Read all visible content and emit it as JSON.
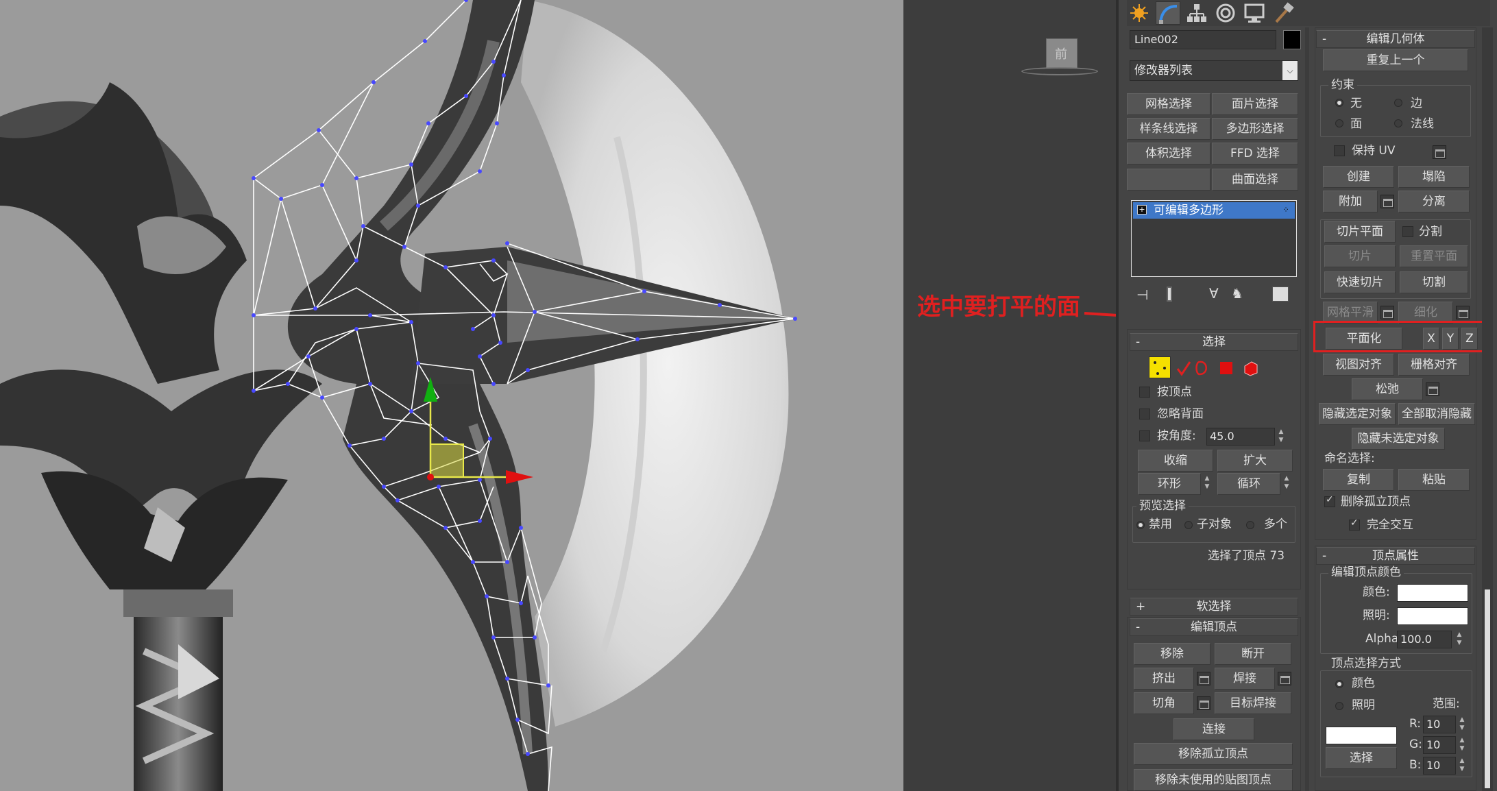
{
  "annotation": {
    "text": "选中要打平的面",
    "color": "#e02020"
  },
  "viewport": {
    "label": "前",
    "background": "#9a9a9a"
  },
  "command_tabs": [
    "create-icon",
    "modify-icon",
    "hierarchy-icon",
    "motion-icon",
    "display-icon",
    "utilities-icon"
  ],
  "object": {
    "name": "Line002",
    "color": "#000000"
  },
  "modifier_list": {
    "label": "修改器列表"
  },
  "modifier_buttons": [
    {
      "label": "网格选择"
    },
    {
      "label": "面片选择"
    },
    {
      "label": "样条线选择"
    },
    {
      "label": "多边形选择"
    },
    {
      "label": "体积选择"
    },
    {
      "label": "FFD 选择"
    },
    {
      "label": ""
    },
    {
      "label": "曲面选择"
    }
  ],
  "stack": {
    "item": "可编辑多边形"
  },
  "selection": {
    "title": "选择",
    "by_vertex": "按顶点",
    "ignore_backfacing": "忽略背面",
    "by_angle": "按角度:",
    "angle_value": "45.0",
    "shrink": "收缩",
    "grow": "扩大",
    "ring": "环形",
    "loop": "循环",
    "preview_title": "预览选择",
    "preview_off": "禁用",
    "preview_sub": "子对象",
    "preview_multi": "多个",
    "status": "选择了顶点 73"
  },
  "soft_selection": {
    "title": "软选择"
  },
  "edit_vertices": {
    "title": "编辑顶点",
    "remove": "移除",
    "break": "断开",
    "extrude": "挤出",
    "weld": "焊接",
    "chamfer": "切角",
    "target_weld": "目标焊接",
    "connect": "连接",
    "remove_isolated": "移除孤立顶点",
    "remove_unused_map": "移除未使用的贴图顶点"
  },
  "edit_geometry": {
    "title": "编辑几何体",
    "repeat_last": "重复上一个",
    "constraints_title": "约束",
    "c_none": "无",
    "c_edge": "边",
    "c_face": "面",
    "c_normal": "法线",
    "preserve_uv": "保持 UV",
    "create": "创建",
    "collapse": "塌陷",
    "attach": "附加",
    "detach": "分离",
    "slice_plane": "切片平面",
    "split": "分割",
    "slice": "切片",
    "reset_plane": "重置平面",
    "quickslice": "快速切片",
    "cut": "切割",
    "meshsmooth": "网格平滑",
    "tessellate": "细化",
    "make_planar": "平面化",
    "x": "X",
    "y": "Y",
    "z": "Z",
    "view_align": "视图对齐",
    "grid_align": "栅格对齐",
    "relax": "松弛",
    "hide_selected": "隐藏选定对象",
    "unhide_all": "全部取消隐藏",
    "hide_unselected": "隐藏未选定对象",
    "named_selections": "命名选择:",
    "copy": "复制",
    "paste": "粘贴",
    "delete_isolated": "删除孤立顶点",
    "full_interactivity": "完全交互"
  },
  "vertex_properties": {
    "title": "顶点属性",
    "edit_color_title": "编辑顶点颜色",
    "color": "颜色:",
    "illumination": "照明:",
    "alpha_label": "Alpha:",
    "alpha_value": "100.0",
    "select_by_title": "顶点选择方式",
    "by_color": "颜色",
    "by_illum": "照明",
    "range": "范围:",
    "r_label": "R:",
    "r": "10",
    "g_label": "G:",
    "g": "10",
    "b_label": "B:",
    "b": "10",
    "select": "选择"
  }
}
